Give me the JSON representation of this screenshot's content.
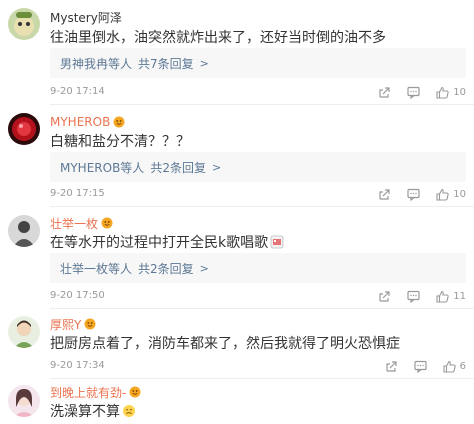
{
  "comments": [
    {
      "user": "Mystery阿泽",
      "text": "往油里倒水，油突然就炸出来了，还好当时倒的油不多",
      "replies_summary": "男神我冉等人",
      "replies_count": "共7条回复",
      "time": "9-20 17:14",
      "likes": "10"
    },
    {
      "user": "MYHEROB",
      "text": "白糖和盐分不清？？？",
      "replies_summary": "MYHEROB等人",
      "replies_count": "共2条回复",
      "time": "9-20 17:15",
      "likes": "10"
    },
    {
      "user": "壮举一枚",
      "text": "在等水开的过程中打开全民k歌唱歌",
      "replies_summary": "壮举一枚等人",
      "replies_count": "共2条回复",
      "time": "9-20 17:50",
      "likes": "11"
    },
    {
      "user": "厚熙Y",
      "text": "把厨房点着了，消防车都来了，然后我就得了明火恐惧症",
      "time": "9-20 17:34",
      "likes": "6"
    },
    {
      "user": "到晚上就有劲-",
      "text": "洗澡算不算"
    }
  ],
  "icons": {
    "share": "share-icon",
    "comment": "comment-icon",
    "like": "thumbs-up-icon",
    "vip": "vip-badge-icon",
    "reply_chevron": "chevron-right-icon"
  },
  "colors": {
    "link": "#5d7895",
    "vip_name": "#eb7350",
    "meta": "#999999"
  }
}
